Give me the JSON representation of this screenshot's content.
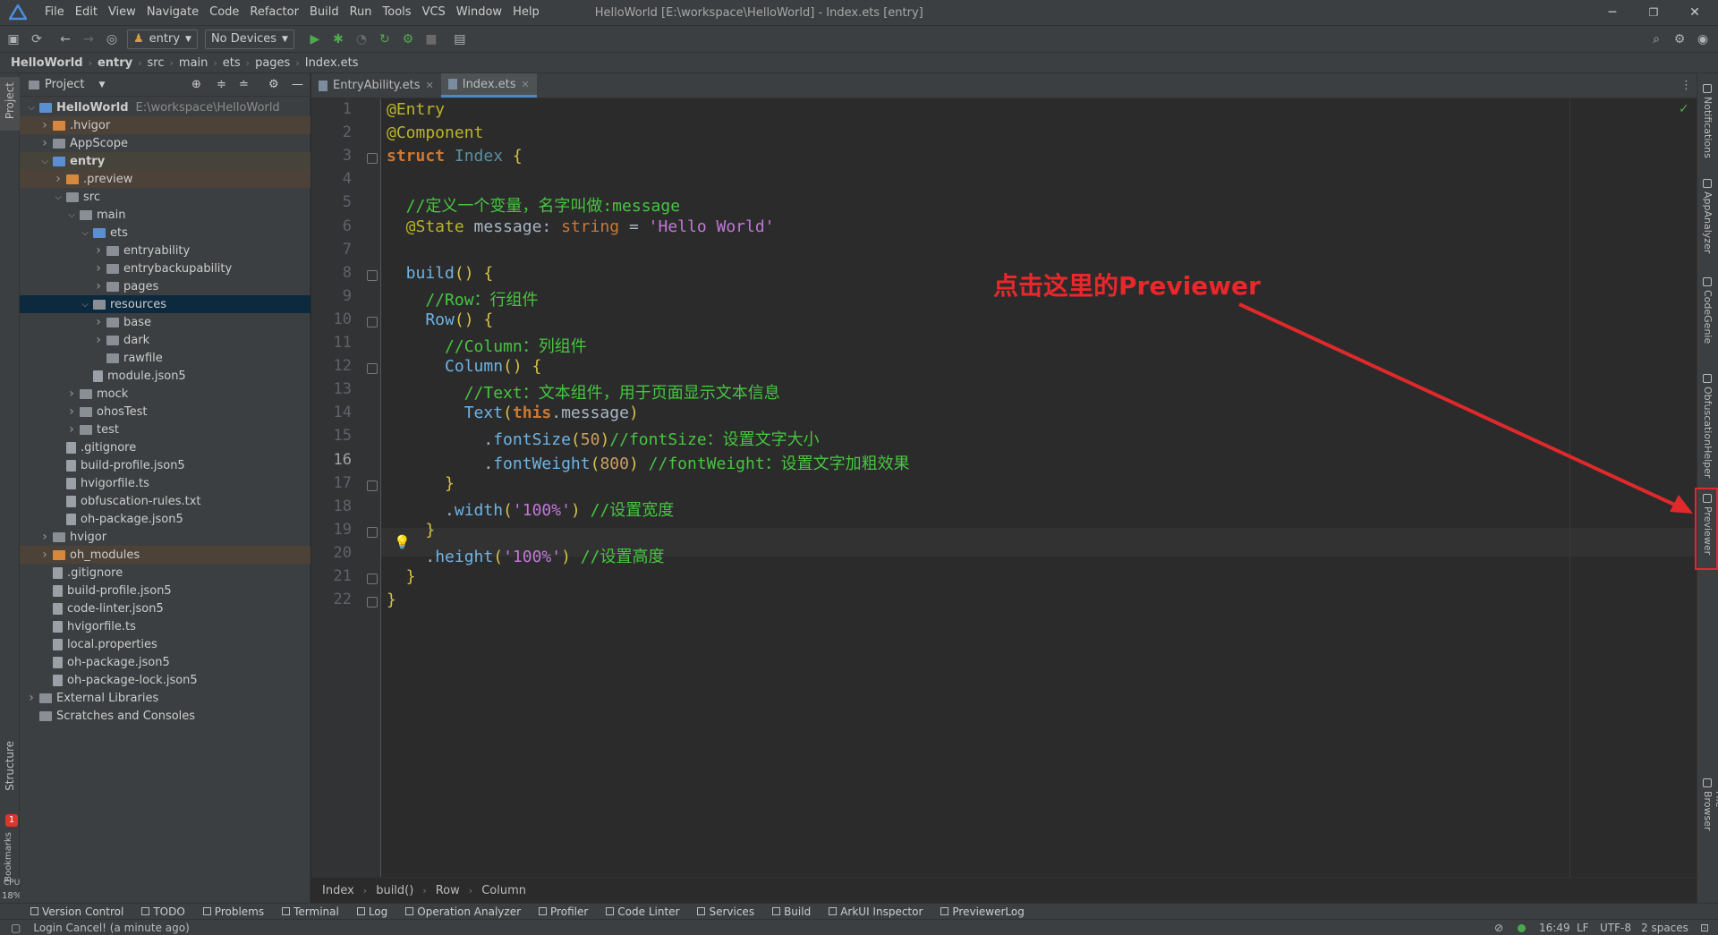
{
  "window": {
    "title": "HelloWorld [E:\\workspace\\HelloWorld] - Index.ets [entry]",
    "min": "─",
    "max": "❐",
    "close": "✕"
  },
  "menu": [
    "File",
    "Edit",
    "View",
    "Navigate",
    "Code",
    "Refactor",
    "Build",
    "Run",
    "Tools",
    "VCS",
    "Window",
    "Help"
  ],
  "toolbar": {
    "module": "entry",
    "device": "No Devices"
  },
  "nav_crumbs": [
    "HelloWorld",
    "entry",
    "src",
    "main",
    "ets",
    "pages",
    "Index.ets"
  ],
  "left_strip": {
    "project": "Project",
    "structure": "Structure",
    "bookmarks": "Bookmarks",
    "badge": "1",
    "cpu_label": "CPU",
    "cpu_value": "18%"
  },
  "project": {
    "header": "Project",
    "root_hint": "E:\\workspace\\HelloWorld",
    "tree": [
      {
        "label": "HelloWorld",
        "depth": 0,
        "arrow": "open",
        "kind": "folder-blue",
        "bold": true,
        "bg": "none"
      },
      {
        "label": ".hvigor",
        "depth": 1,
        "arrow": "closed",
        "kind": "folder-orange",
        "bg": "ex"
      },
      {
        "label": "AppScope",
        "depth": 1,
        "arrow": "closed",
        "kind": "folder",
        "bg": "none"
      },
      {
        "label": "entry",
        "depth": 1,
        "arrow": "open",
        "kind": "folder-blue",
        "bold": true,
        "bg": "exd"
      },
      {
        "label": ".preview",
        "depth": 2,
        "arrow": "closed",
        "kind": "folder-orange",
        "bg": "ex"
      },
      {
        "label": "src",
        "depth": 2,
        "arrow": "open",
        "kind": "folder",
        "bg": "none"
      },
      {
        "label": "main",
        "depth": 3,
        "arrow": "open",
        "kind": "folder",
        "bg": "none"
      },
      {
        "label": "ets",
        "depth": 4,
        "arrow": "open",
        "kind": "folder-blue",
        "bg": "none"
      },
      {
        "label": "entryability",
        "depth": 5,
        "arrow": "closed",
        "kind": "folder",
        "bg": "none"
      },
      {
        "label": "entrybackupability",
        "depth": 5,
        "arrow": "closed",
        "kind": "folder",
        "bg": "none"
      },
      {
        "label": "pages",
        "depth": 5,
        "arrow": "closed",
        "kind": "folder",
        "bg": "none"
      },
      {
        "label": "resources",
        "depth": 4,
        "arrow": "open",
        "kind": "folder",
        "bg": "sel"
      },
      {
        "label": "base",
        "depth": 5,
        "arrow": "closed",
        "kind": "folder",
        "bg": "none"
      },
      {
        "label": "dark",
        "depth": 5,
        "arrow": "closed",
        "kind": "folder",
        "bg": "none"
      },
      {
        "label": "rawfile",
        "depth": 5,
        "arrow": "none",
        "kind": "folder",
        "bg": "none"
      },
      {
        "label": "module.json5",
        "depth": 4,
        "arrow": "none",
        "kind": "file",
        "bg": "none"
      },
      {
        "label": "mock",
        "depth": 3,
        "arrow": "closed",
        "kind": "folder",
        "bg": "none"
      },
      {
        "label": "ohosTest",
        "depth": 3,
        "arrow": "closed",
        "kind": "folder",
        "bg": "none"
      },
      {
        "label": "test",
        "depth": 3,
        "arrow": "closed",
        "kind": "folder",
        "bg": "none"
      },
      {
        "label": ".gitignore",
        "depth": 2,
        "arrow": "none",
        "kind": "file",
        "bg": "none"
      },
      {
        "label": "build-profile.json5",
        "depth": 2,
        "arrow": "none",
        "kind": "file",
        "bg": "none"
      },
      {
        "label": "hvigorfile.ts",
        "depth": 2,
        "arrow": "none",
        "kind": "file",
        "bg": "none"
      },
      {
        "label": "obfuscation-rules.txt",
        "depth": 2,
        "arrow": "none",
        "kind": "file",
        "bg": "none"
      },
      {
        "label": "oh-package.json5",
        "depth": 2,
        "arrow": "none",
        "kind": "file",
        "bg": "none"
      },
      {
        "label": "hvigor",
        "depth": 1,
        "arrow": "closed",
        "kind": "folder",
        "bg": "none"
      },
      {
        "label": "oh_modules",
        "depth": 1,
        "arrow": "closed",
        "kind": "folder-orange",
        "bg": "ex"
      },
      {
        "label": ".gitignore",
        "depth": 1,
        "arrow": "none",
        "kind": "file",
        "bg": "none"
      },
      {
        "label": "build-profile.json5",
        "depth": 1,
        "arrow": "none",
        "kind": "file",
        "bg": "none"
      },
      {
        "label": "code-linter.json5",
        "depth": 1,
        "arrow": "none",
        "kind": "file",
        "bg": "none"
      },
      {
        "label": "hvigorfile.ts",
        "depth": 1,
        "arrow": "none",
        "kind": "file",
        "bg": "none"
      },
      {
        "label": "local.properties",
        "depth": 1,
        "arrow": "none",
        "kind": "file",
        "bg": "none"
      },
      {
        "label": "oh-package.json5",
        "depth": 1,
        "arrow": "none",
        "kind": "file",
        "bg": "none"
      },
      {
        "label": "oh-package-lock.json5",
        "depth": 1,
        "arrow": "none",
        "kind": "file",
        "bg": "none"
      },
      {
        "label": "External Libraries",
        "depth": 0,
        "arrow": "closed",
        "kind": "folder",
        "bg": "none"
      },
      {
        "label": "Scratches and Consoles",
        "depth": 0,
        "arrow": "none",
        "kind": "folder",
        "bg": "none"
      }
    ]
  },
  "tabs": [
    {
      "label": "EntryAbility.ets",
      "active": false
    },
    {
      "label": "Index.ets",
      "active": true
    }
  ],
  "code": [
    [
      [
        "dec",
        "@Entry"
      ]
    ],
    [
      [
        "dec",
        "@Component"
      ]
    ],
    [
      [
        "kw",
        "struct "
      ],
      [
        "cls",
        "Index "
      ],
      [
        "br",
        "{"
      ]
    ],
    [],
    [
      [
        "cm",
        "  //定义一个变量，名字叫做:message"
      ]
    ],
    [
      [
        "dec",
        "  @State "
      ],
      [
        "pl",
        "message: "
      ],
      [
        "ty",
        "string "
      ],
      [
        "pl",
        "= "
      ],
      [
        "str",
        "'Hello World'"
      ]
    ],
    [],
    [
      [
        "fn",
        "  build"
      ],
      [
        "br",
        "() {"
      ]
    ],
    [
      [
        "cm",
        "    //Row：行组件"
      ]
    ],
    [
      [
        "fn",
        "    Row"
      ],
      [
        "br",
        "() {"
      ]
    ],
    [
      [
        "cm",
        "      //Column：列组件"
      ]
    ],
    [
      [
        "fn",
        "      Column"
      ],
      [
        "br",
        "() {"
      ]
    ],
    [
      [
        "cm",
        "        //Text：文本组件，用于页面显示文本信息"
      ]
    ],
    [
      [
        "fn",
        "        Text"
      ],
      [
        "br",
        "("
      ],
      [
        "kw",
        "this"
      ],
      [
        "pl",
        ".message"
      ],
      [
        "br",
        ")"
      ]
    ],
    [
      [
        "pl",
        "          ."
      ],
      [
        "fn",
        "fontSize"
      ],
      [
        "br",
        "("
      ],
      [
        "num",
        "50"
      ],
      [
        "br",
        ")"
      ],
      [
        "cm",
        "//fontSize：设置文字大小"
      ]
    ],
    [
      [
        "pl",
        "          ."
      ],
      [
        "fn",
        "fontWeight"
      ],
      [
        "br",
        "("
      ],
      [
        "num",
        "800"
      ],
      [
        "br",
        ") "
      ],
      [
        "cm",
        "//fontWeight：设置文字加粗效果"
      ]
    ],
    [
      [
        "br",
        "      }"
      ]
    ],
    [
      [
        "pl",
        "      ."
      ],
      [
        "fn",
        "width"
      ],
      [
        "br",
        "("
      ],
      [
        "str",
        "'100%'"
      ],
      [
        "br",
        ") "
      ],
      [
        "cm",
        "//设置宽度"
      ]
    ],
    [
      [
        "br",
        "    }"
      ]
    ],
    [
      [
        "pl",
        "    ."
      ],
      [
        "fn",
        "height"
      ],
      [
        "br",
        "("
      ],
      [
        "str",
        "'100%'"
      ],
      [
        "br",
        ") "
      ],
      [
        "cm",
        "//设置高度"
      ]
    ],
    [
      [
        "br",
        "  }"
      ]
    ],
    [
      [
        "br",
        "}"
      ]
    ]
  ],
  "current_line": 16,
  "ed_crumbs": [
    "Index",
    "build()",
    "Row",
    "Column"
  ],
  "right_strip": [
    "Notifications",
    "AppAnalyzer",
    "CodeGenie",
    "ObfuscationHelper",
    "Previewer",
    "Device File Browser"
  ],
  "bottom_tools": [
    "Version Control",
    "TODO",
    "Problems",
    "Terminal",
    "Log",
    "Operation Analyzer",
    "Profiler",
    "Code Linter",
    "Services",
    "Build",
    "ArkUI Inspector",
    "PreviewerLog"
  ],
  "status": {
    "message": "Login Cancel! (a minute ago)",
    "time": "16:49",
    "eol": "LF",
    "encoding": "UTF-8",
    "indent": "2 spaces"
  },
  "annotation": "点击这里的Previewer",
  "colors": {
    "annotation": "#e8282b",
    "accent": "#4a88c7"
  }
}
